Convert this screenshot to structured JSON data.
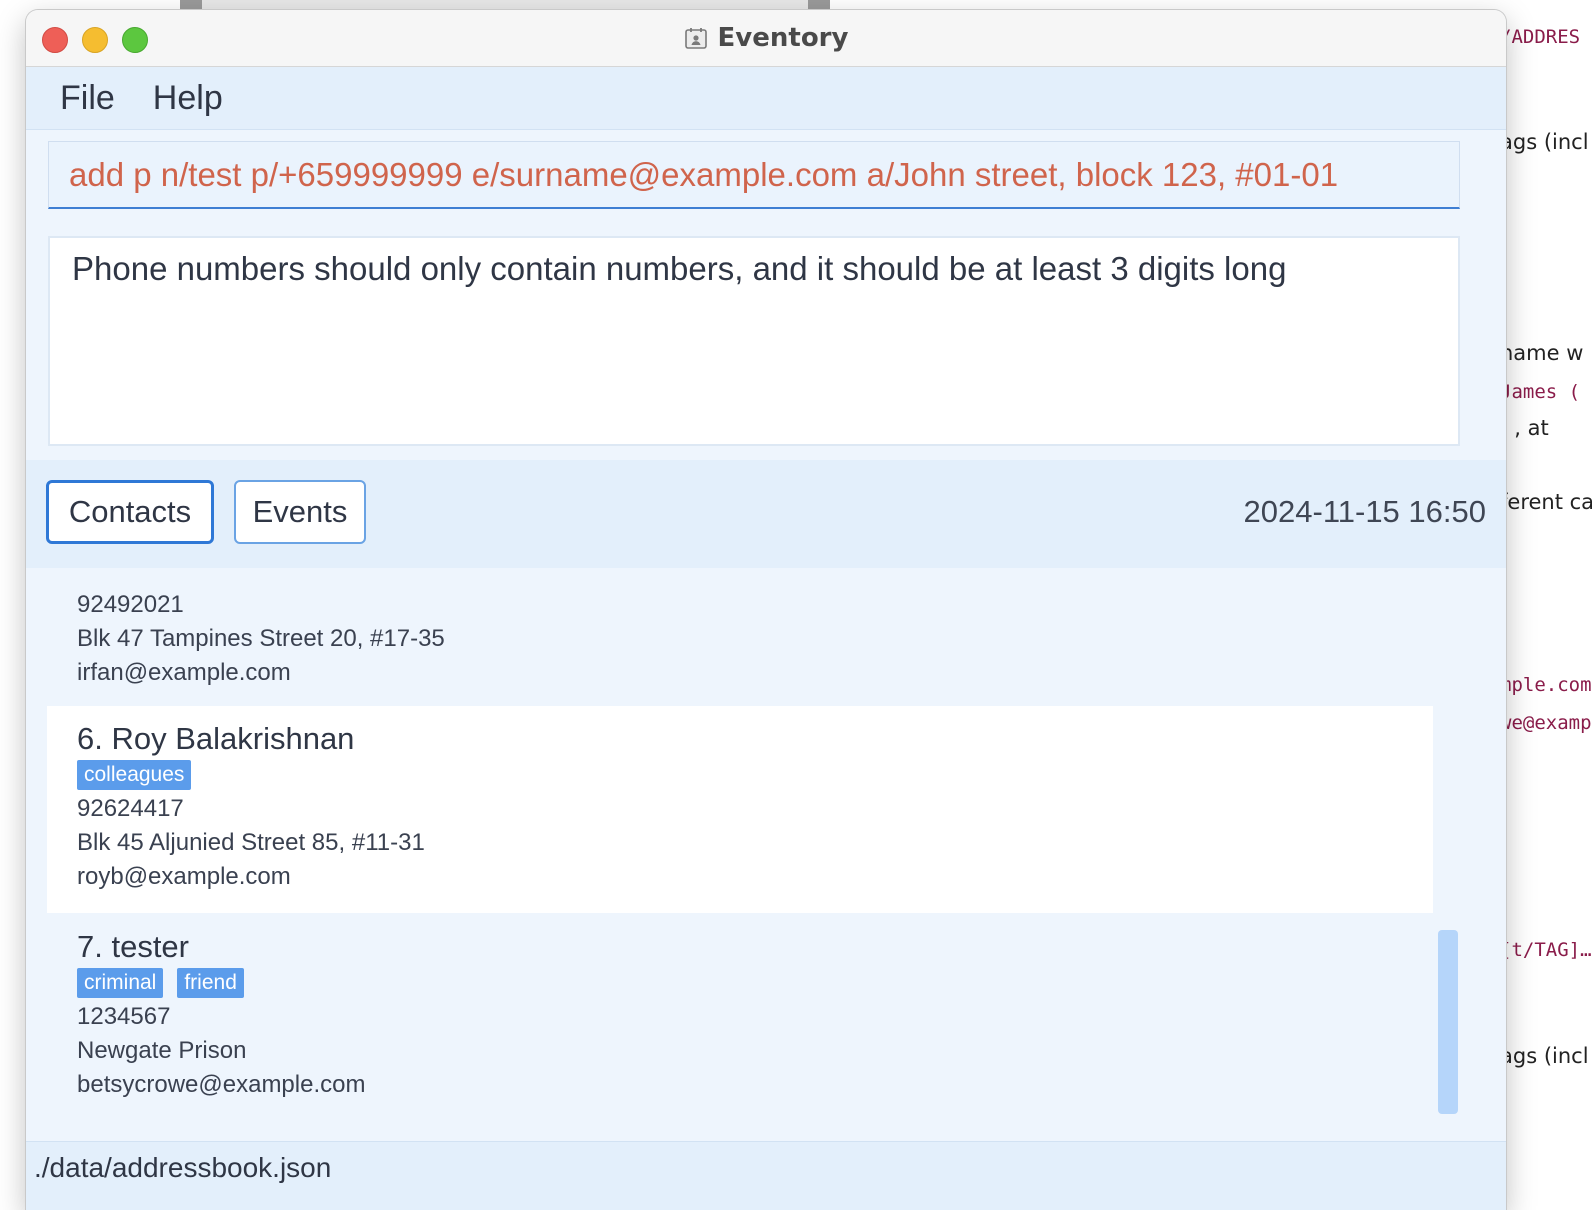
{
  "window": {
    "title": "Eventory"
  },
  "menu": {
    "file": "File",
    "help": "Help"
  },
  "command": {
    "value": "add p n/test p/+659999999 e/surname@example.com a/John street, block 123, #01-01"
  },
  "result": {
    "message": "Phone numbers should only contain numbers, and it should be at least 3 digits long"
  },
  "tabs": {
    "contacts": "Contacts",
    "events": "Events"
  },
  "datetime": "2024-11-15 16:50",
  "contacts": [
    {
      "phone": "92492021",
      "address": "Blk 47 Tampines Street 20, #17-35",
      "email": "irfan@example.com"
    },
    {
      "name": "6. Roy Balakrishnan",
      "tags": [
        "colleagues"
      ],
      "phone": "92624417",
      "address": "Blk 45 Aljunied Street 85, #11-31",
      "email": "royb@example.com"
    },
    {
      "name": "7. tester",
      "tags": [
        "criminal",
        "friend"
      ],
      "phone": "1234567",
      "address": "Newgate Prison",
      "email": "betsycrowe@example.com"
    }
  ],
  "status": {
    "path": "./data/addressbook.json"
  },
  "background": {
    "lines": [
      "/ADDRES",
      "ags (incl",
      "name w",
      "James (",
      "- , at",
      "ferent ca",
      "mple.com",
      "we@examp",
      "[t/TAG]…",
      "ags (incl"
    ]
  },
  "colors": {
    "accent": "#2f78d6",
    "command_text": "#d0644c",
    "tag_bg": "#5b9ceb",
    "window_bg": "#eef5fd"
  }
}
